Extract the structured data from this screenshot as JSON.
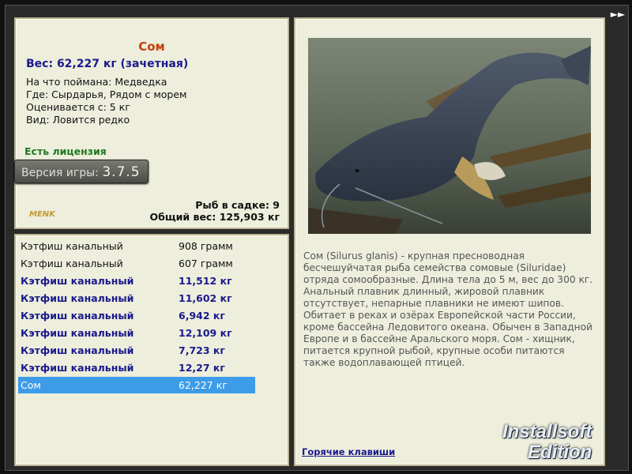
{
  "info": {
    "title": "Сом",
    "weight": "Вес: 62,227 кг (зачетная)",
    "caught_on": "На что поймана: Медведка",
    "location": "Где: Сырдарья, Рядом с морем",
    "rated_from": "Оценивается с: 5 кг",
    "rarity": "Вид: Ловится редко",
    "license": "Есть лицензия",
    "version_label": "Версия игры: ",
    "version_number": "3.7.5",
    "logo_text": "MENK",
    "fish_in_net": "Рыб в садке: 9",
    "total_weight": "Общий вес: 125,903 кг"
  },
  "catch_list": [
    {
      "name": "Кэтфиш канальный",
      "weight": "908 грамм",
      "style": "normal"
    },
    {
      "name": "Кэтфиш канальный",
      "weight": "607 грамм",
      "style": "normal"
    },
    {
      "name": "Кэтфиш канальный",
      "weight": "11,512 кг",
      "style": "bold"
    },
    {
      "name": "Кэтфиш канальный",
      "weight": "11,602 кг",
      "style": "bold"
    },
    {
      "name": "Кэтфиш канальный",
      "weight": "6,942 кг",
      "style": "bold"
    },
    {
      "name": "Кэтфиш канальный",
      "weight": "12,109 кг",
      "style": "bold"
    },
    {
      "name": "Кэтфиш канальный",
      "weight": "7,723 кг",
      "style": "bold"
    },
    {
      "name": "Кэтфиш канальный",
      "weight": "12,27 кг",
      "style": "bold"
    },
    {
      "name": "Сом",
      "weight": "62,227 кг",
      "style": "sel"
    }
  ],
  "detail": {
    "description": "Сом (Silurus glanis) - крупная пресноводная бесчешуйчатая рыба семейства сомовые (Siluridae) отряда сомообразные. Длина тела до 5 м, вес до 300 кг. Анальный плавник длинный, жировой плавник отсутствует, непарные плавники не имеют шипов. Обитает в реках и озёрах Европейской части России, кроме бассейна Ледовитого океана. Обычен в Западной Европе и в бассейне Аральского моря. Сом - хищник, питается крупной рыбой, крупные особи питаются также водоплавающей птицей.",
    "hotkeys": "Горячие клавиши"
  },
  "nav": {
    "next": "►►"
  },
  "watermark": {
    "line1": "Installsoft",
    "line2": "Edition"
  },
  "colors": {
    "accent_title": "#c2410c",
    "link": "#1a1a8c",
    "license": "#1f7a1f",
    "selection": "#3d9ce8",
    "panel_bg": "#eeeedd"
  }
}
